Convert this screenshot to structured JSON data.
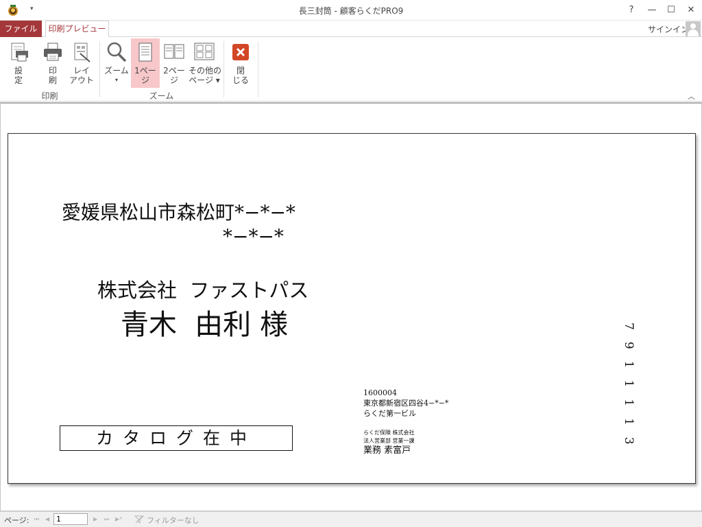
{
  "window": {
    "title": "長三封筒 - 顧客らくだPRO9",
    "help": "?",
    "minimize": "—",
    "maximize": "☐",
    "close": "✕",
    "qat_arrow": "▾"
  },
  "tabs": {
    "file": "ファイル",
    "print_preview": "印刷プレビュー"
  },
  "signin": "サインイン",
  "ribbon": {
    "settings": "設\n定",
    "print": "印\n刷",
    "layout": "レイ\nアウト",
    "zoom": "ズーム",
    "zoom_arrow": "▾",
    "one_page": "1ペー\nジ",
    "two_page": "2ペー\nジ",
    "other_pages": "その他の\nページ ▾",
    "close": "閉\nじる",
    "group_print": "印刷",
    "group_zoom": "ズーム",
    "collapse": "︿"
  },
  "envelope": {
    "address_line1": "愛媛県松山市森松町*−*−*",
    "address_line2": "*−*−*",
    "company": "株式会社  ファストパス",
    "person": "青木  由利 様",
    "catalog": "カタログ在中",
    "sender_zip": "1600004",
    "sender_address": "東京都新宿区四谷4−*−*",
    "sender_building": "らくだ第一ビル",
    "sender_company": "らくだ保険 株式会社",
    "sender_dept": "法人営業部  営業一課",
    "sender_name": "業務  素富戸",
    "postal_code": "7911113"
  },
  "statusbar": {
    "page_label": "ページ:",
    "first": "⏮",
    "prev": "◀",
    "page_value": "1",
    "next": "▶",
    "last": "⏭",
    "new": "▶*",
    "filter": "フィルターなし"
  },
  "colors": {
    "accent": "#a4373a",
    "active_button": "#f7c7c9"
  }
}
